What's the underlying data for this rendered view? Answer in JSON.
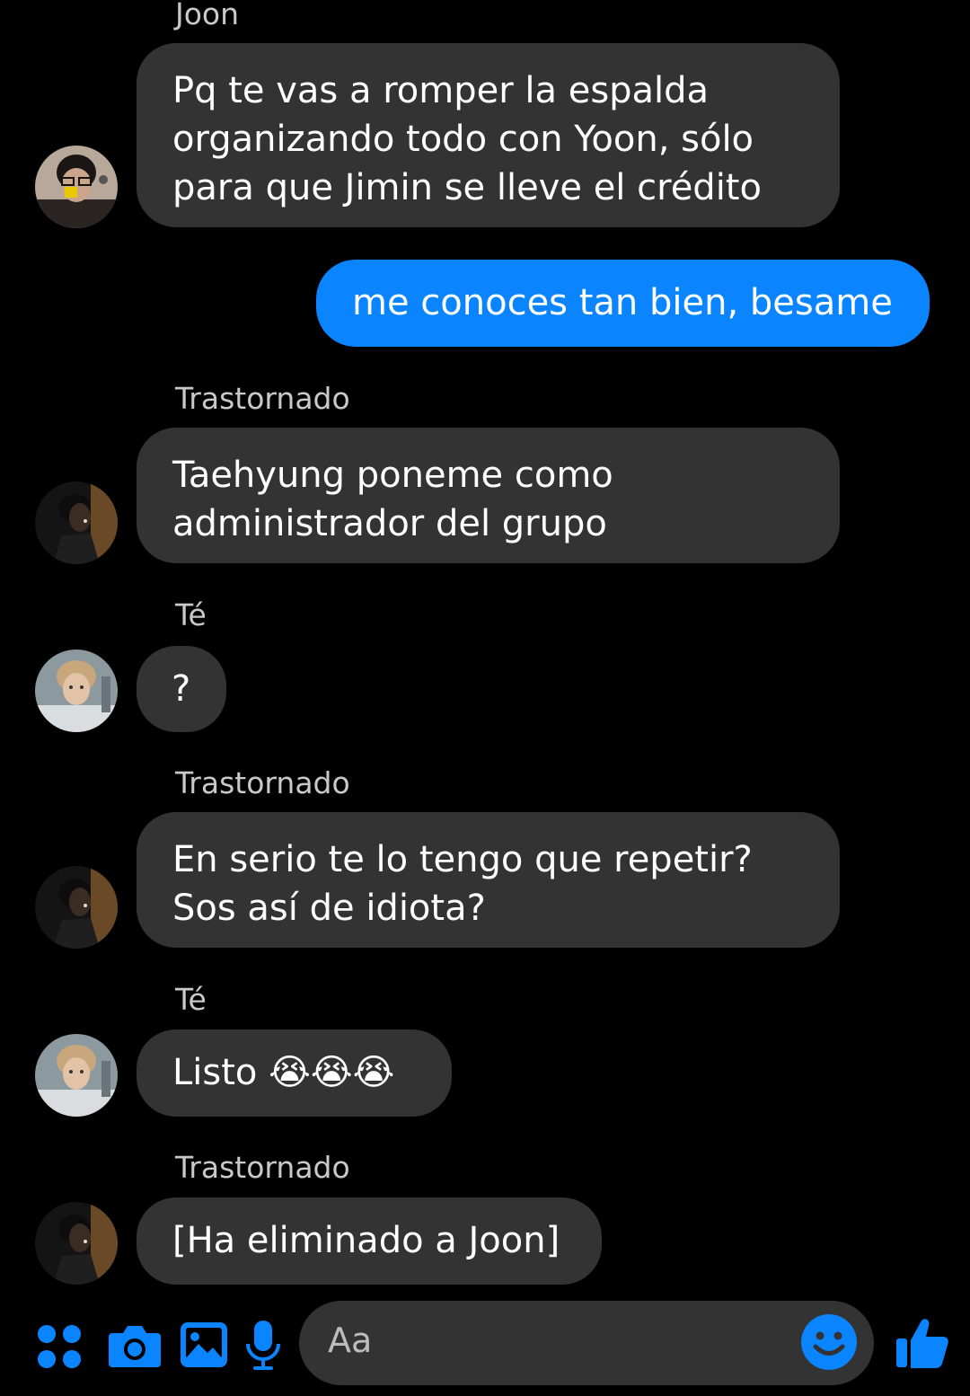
{
  "thread": [
    {
      "sender": "Joon",
      "text": "Pq te vas a romper la espalda\norganizando todo con Yoon, sólo\npara que Jimin se lleve el crédito"
    },
    {
      "text": "me conoces tan bien, besame"
    },
    {
      "sender": "Trastornado",
      "text": "Taehyung poneme como\nadministrador del grupo"
    },
    {
      "sender": "Té",
      "text": "?"
    },
    {
      "sender": "Trastornado",
      "text": "En serio te lo tengo que repetir?\nSos así de idiota?"
    },
    {
      "sender": "Té",
      "text": "Listo 😭😭😭"
    },
    {
      "sender": "Trastornado",
      "text": "[Ha eliminado a Joon]"
    }
  ],
  "composer": {
    "placeholder": "Aa",
    "icons": [
      "apps-icon",
      "camera-icon",
      "gallery-icon",
      "microphone-icon",
      "emoji-icon",
      "thumbs-up-icon"
    ]
  },
  "colors": {
    "accent": "#0a84ff",
    "incoming_bubble": "#333333",
    "background": "#000000"
  }
}
